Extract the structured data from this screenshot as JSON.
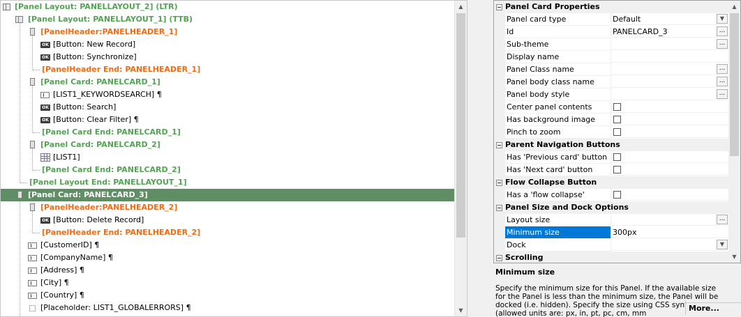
{
  "tree": {
    "rows": [
      {
        "label": "[Panel Layout: PANELLAYOUT_2] (LTR)"
      },
      {
        "label": "[Panel Layout: PANELLAYOUT_1] (TTB)"
      },
      {
        "label": "[PanelHeader:PANELHEADER_1]"
      },
      {
        "label": "[Button: New Record]"
      },
      {
        "label": "[Button: Synchronize]"
      },
      {
        "label": "[PanelHeader End: PANELHEADER_1]"
      },
      {
        "label": "[Panel Card: PANELCARD_1]"
      },
      {
        "label": "[LIST1_KEYWORDSEARCH] ¶"
      },
      {
        "label": "[Button: Search]"
      },
      {
        "label": "[Button: Clear Filter] ¶"
      },
      {
        "label": "[Panel Card End: PANELCARD_1]"
      },
      {
        "label": "[Panel Card: PANELCARD_2]"
      },
      {
        "label": "[LIST1]"
      },
      {
        "label": "[Panel Card End: PANELCARD_2]"
      },
      {
        "label": "[Panel Layout End: PANELLAYOUT_1]"
      },
      {
        "label": "[Panel Card: PANELCARD_3]"
      },
      {
        "label": "[PanelHeader:PANELHEADER_2]"
      },
      {
        "label": "[Button: Delete Record]"
      },
      {
        "label": "[PanelHeader End: PANELHEADER_2]"
      },
      {
        "label": "[CustomerID] ¶"
      },
      {
        "label": "[CompanyName] ¶"
      },
      {
        "label": "[Address] ¶"
      },
      {
        "label": "[City] ¶"
      },
      {
        "label": "[Country] ¶"
      },
      {
        "label": "[Placeholder: LIST1_GLOBALERRORS] ¶"
      }
    ],
    "ok_icon_text": "OK"
  },
  "props": {
    "cat1": "Panel Card Properties",
    "panel_card_type": {
      "name": "Panel card type",
      "value": "Default"
    },
    "id": {
      "name": "Id",
      "value": "PANELCARD_3"
    },
    "sub_theme": {
      "name": "Sub-theme"
    },
    "display_name": {
      "name": "Display name"
    },
    "panel_class": {
      "name": "Panel Class name"
    },
    "body_class": {
      "name": "Panel body class name"
    },
    "body_style": {
      "name": "Panel body style"
    },
    "center": {
      "name": "Center panel contents"
    },
    "bg_image": {
      "name": "Has background image"
    },
    "pinch": {
      "name": "Pinch to zoom"
    },
    "cat2": "Parent Navigation Buttons",
    "prev": {
      "name": "Has 'Previous card' button"
    },
    "next": {
      "name": "Has 'Next card' button"
    },
    "cat3": "Flow Collapse Button",
    "flow": {
      "name": "Has a 'flow collapse' button"
    },
    "cat4": "Panel Size and Dock Options",
    "layout_size": {
      "name": "Layout size"
    },
    "min_size": {
      "name": "Minimum size",
      "value": "300px"
    },
    "dock": {
      "name": "Dock"
    },
    "cat5": "Scrolling",
    "dots": "...",
    "minus": "−"
  },
  "description": {
    "title": "Minimum size",
    "text": "Specify the minimum size for this Panel. If the available size for the Panel is less than the minimum size, the Panel will be docked (i.e. hidden). Specify the size using CSS syntax (allowed units are: px, in, pt, pc, cm, mm",
    "more": "More..."
  }
}
